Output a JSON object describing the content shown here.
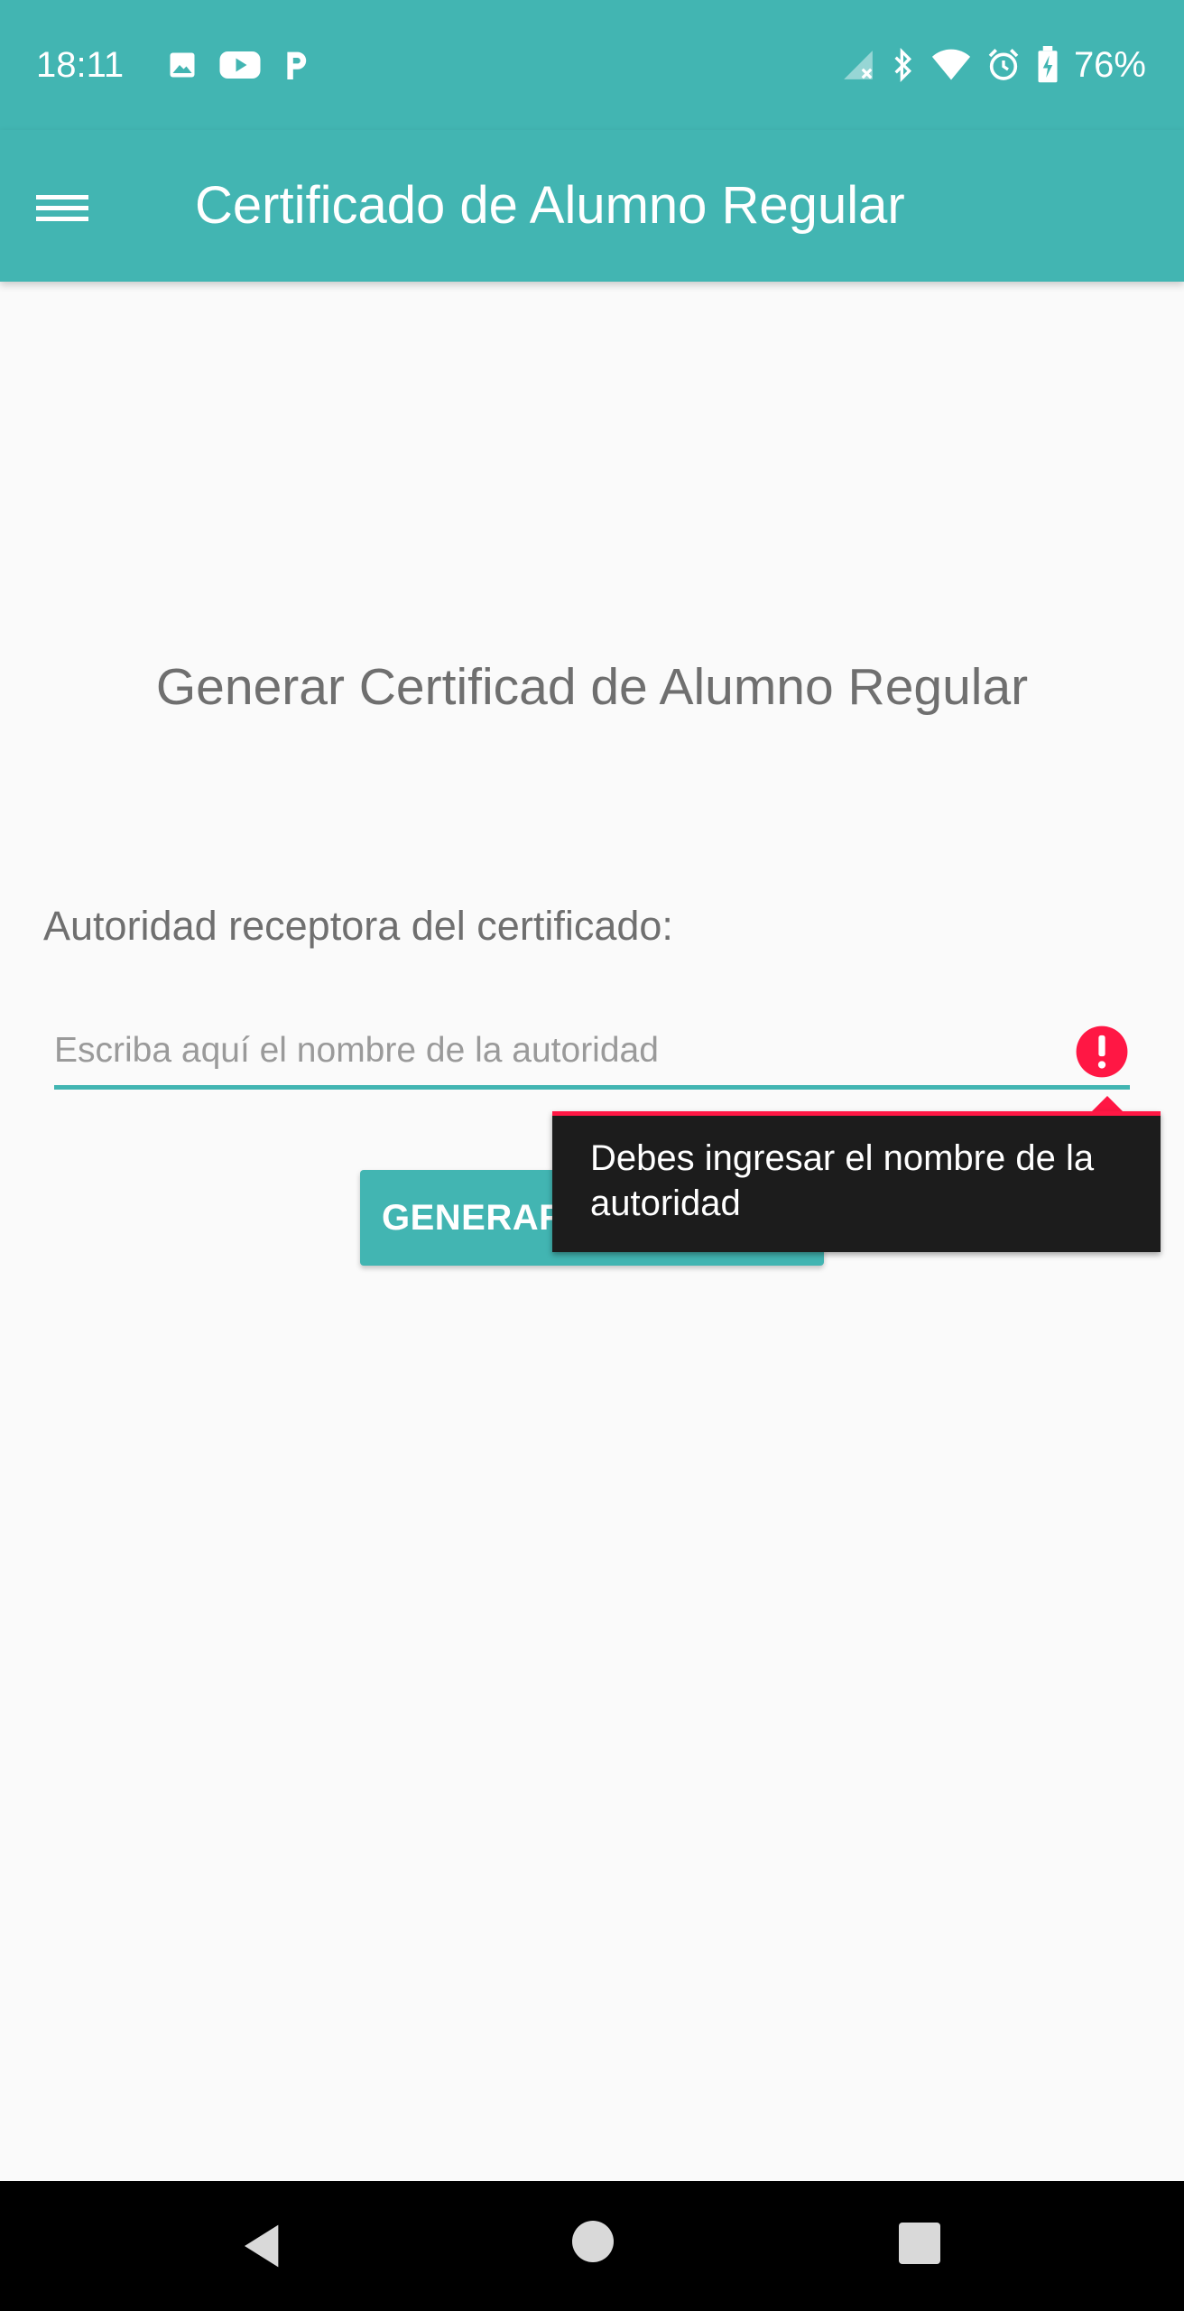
{
  "status_bar": {
    "time": "18:11",
    "battery_percent": "76%",
    "icons_left": [
      "image-icon",
      "youtube-icon",
      "parking-icon"
    ],
    "icons_right": [
      "no-signal-icon",
      "bluetooth-icon",
      "wifi-icon",
      "alarm-icon",
      "battery-charging-icon"
    ]
  },
  "app_bar": {
    "title": "Certificado de Alumno Regular",
    "menu_icon": "hamburger-menu-icon"
  },
  "main": {
    "heading": "Generar Certificad de Alumno Regular",
    "field_label": "Autoridad receptora del certificado:",
    "input": {
      "value": "",
      "placeholder": "Escriba aquí el nombre de la autoridad"
    },
    "button_label": "GENERAR CERTIFICADO",
    "error_message": "Debes ingresar el nombre de la autoridad"
  },
  "nav_bar": {
    "icons": [
      "back-icon",
      "home-icon",
      "recents-icon"
    ]
  },
  "colors": {
    "accent": "#42b5b2",
    "error": "#ff1744",
    "popup_background": "#1c1c1c",
    "navbar": "#000000"
  }
}
